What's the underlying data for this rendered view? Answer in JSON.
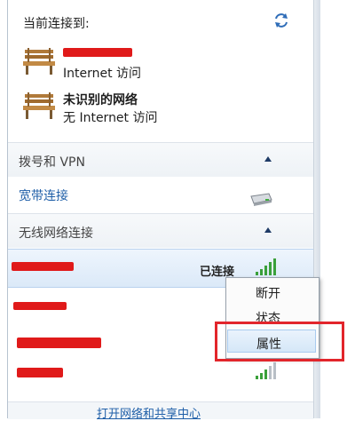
{
  "header": {
    "current_connection": "当前连接到:"
  },
  "networks": [
    {
      "name": "",
      "status": "Internet 访问"
    },
    {
      "name": "未识别的网络",
      "status": "无 Internet 访问"
    }
  ],
  "sections": {
    "dialup": {
      "title": "拨号和 VPN",
      "item": "宽带连接"
    },
    "wireless": {
      "title": "无线网络连接",
      "connected_label": "已连接"
    }
  },
  "context_menu": {
    "items": [
      "断开",
      "状态",
      "属性"
    ]
  },
  "footer": {
    "link": "打开网络和共享中心"
  },
  "colors": {
    "link": "#1f5fa8",
    "redaction": "#e01a1a",
    "annotation": "#e2252b"
  }
}
